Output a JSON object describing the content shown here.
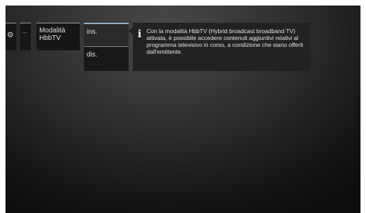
{
  "menu": {
    "settings_icon": "gear-icon",
    "ellipsis": "...",
    "current_item": "Modalità HbbTV"
  },
  "options": {
    "on_label": "ins.",
    "off_label": "dis.",
    "selected": "ins."
  },
  "info": {
    "icon": "info-icon",
    "text": "Con la modalità HbbTV (Hybrid broadcast broadband TV) attivata, è possibile accedere contenuti aggiuntivi relativi al programma televisivo in corso, a condizione che siano offerti dall'emittente."
  },
  "colors": {
    "accent": "#8fb0c8",
    "panel": "#222222",
    "text": "#e6e6e6"
  }
}
